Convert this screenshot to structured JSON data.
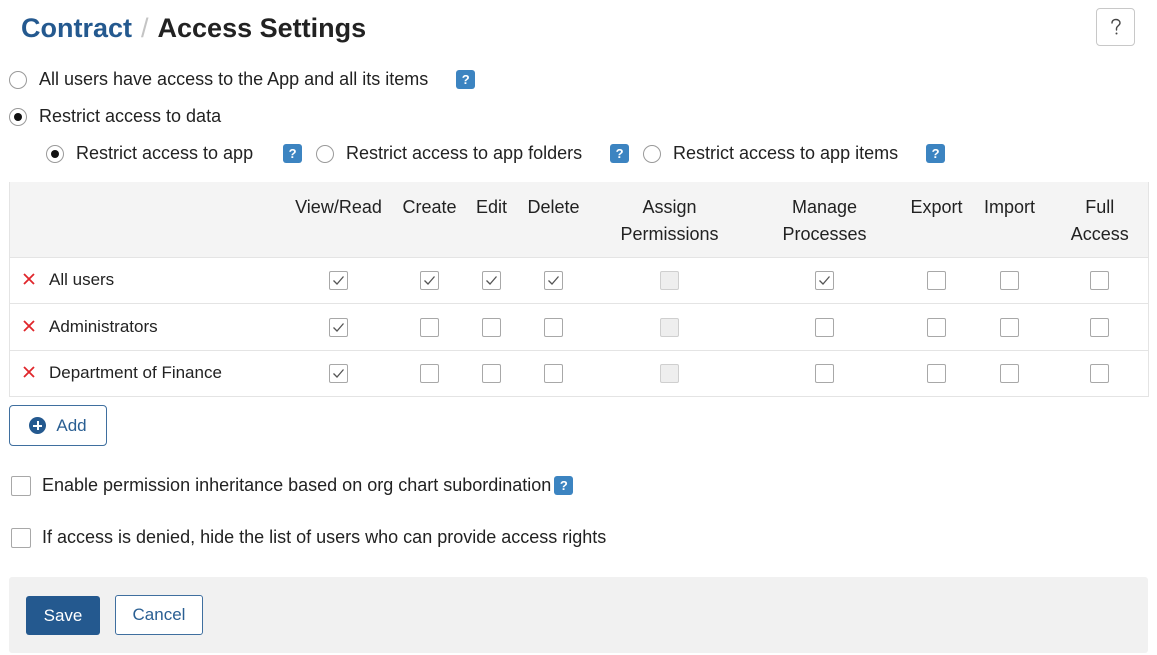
{
  "header": {
    "breadcrumb_link": "Contract",
    "separator": "/",
    "title": "Access Settings",
    "help_icon": "question-icon"
  },
  "access_mode": {
    "all_users_label": "All users have access to the App and all its items",
    "restrict_label": "Restrict access to data",
    "selected": "restrict"
  },
  "restrict_scope": {
    "app_label": "Restrict access to app",
    "folders_label": "Restrict access to app folders",
    "items_label": "Restrict access to app items",
    "selected": "app"
  },
  "help_badge_text": "?",
  "permissions_table": {
    "columns": [
      {
        "id": "view",
        "line1": "View/Read",
        "line2": ""
      },
      {
        "id": "create",
        "line1": "Create",
        "line2": ""
      },
      {
        "id": "edit",
        "line1": "Edit",
        "line2": ""
      },
      {
        "id": "delete",
        "line1": "Delete",
        "line2": ""
      },
      {
        "id": "assign",
        "line1": "Assign",
        "line2": "Permissions"
      },
      {
        "id": "manage",
        "line1": "Manage",
        "line2": "Processes"
      },
      {
        "id": "export",
        "line1": "Export",
        "line2": ""
      },
      {
        "id": "import",
        "line1": "Import",
        "line2": ""
      },
      {
        "id": "full",
        "line1": "Full",
        "line2": "Access"
      }
    ],
    "rows": [
      {
        "name": "All users",
        "view": true,
        "create": true,
        "edit": true,
        "delete": true,
        "assign": false,
        "manage": true,
        "export": false,
        "import": false,
        "full": false
      },
      {
        "name": "Administrators",
        "view": true,
        "create": false,
        "edit": false,
        "delete": false,
        "assign": false,
        "manage": false,
        "export": false,
        "import": false,
        "full": false
      },
      {
        "name": "Department of Finance",
        "view": true,
        "create": false,
        "edit": false,
        "delete": false,
        "assign": false,
        "manage": false,
        "export": false,
        "import": false,
        "full": false
      }
    ],
    "disabled_columns": [
      "assign"
    ]
  },
  "add_button": {
    "label": "Add",
    "icon": "plus-circle-icon"
  },
  "options": {
    "inheritance_label": "Enable permission inheritance based on org chart subordination",
    "inheritance_checked": false,
    "hide_list_label": "If access is denied, hide the list of users who can provide access rights",
    "hide_list_checked": false
  },
  "footer": {
    "save_label": "Save",
    "cancel_label": "Cancel"
  },
  "colors": {
    "brand": "#24598f",
    "help_badge": "#3c84c1",
    "remove_icon": "#e0262b"
  }
}
